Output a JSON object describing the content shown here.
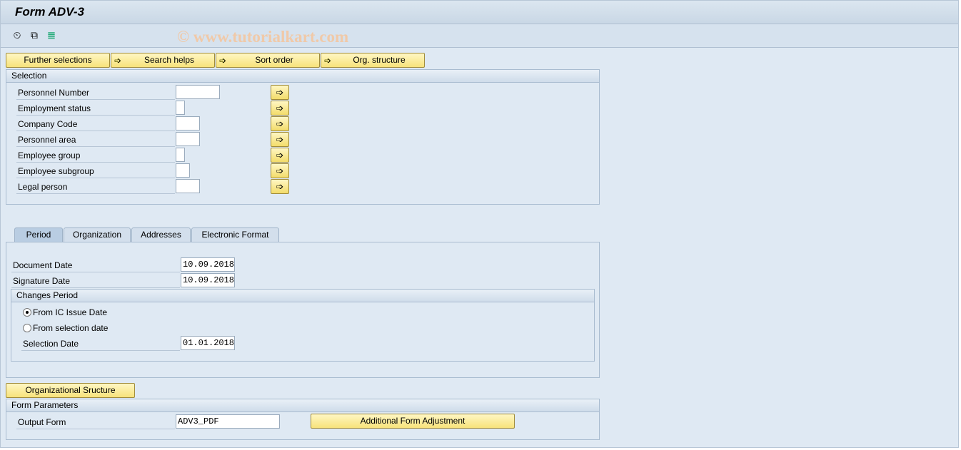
{
  "title": "Form ADV-3",
  "watermark": "© www.tutorialkart.com",
  "toolbar": {
    "icons": [
      "execute-clock-icon",
      "copy-variant-icon",
      "selection-options-icon"
    ]
  },
  "buttons": {
    "further": "Further selections",
    "search": "Search helps",
    "sort": "Sort order",
    "org": "Org. structure"
  },
  "selection": {
    "title": "Selection",
    "fields": [
      {
        "label": "Personnel Number",
        "value": ""
      },
      {
        "label": "Employment status",
        "value": ""
      },
      {
        "label": "Company Code",
        "value": ""
      },
      {
        "label": "Personnel area",
        "value": ""
      },
      {
        "label": "Employee group",
        "value": ""
      },
      {
        "label": "Employee subgroup",
        "value": ""
      },
      {
        "label": "Legal person",
        "value": ""
      }
    ]
  },
  "tabs": [
    "Period",
    "Organization",
    "Addresses",
    "Electronic Format"
  ],
  "period": {
    "document_date_label": "Document Date",
    "document_date": "10.09.2018",
    "signature_date_label": "Signature Date",
    "signature_date": "10.09.2018",
    "changes": {
      "title": "Changes Period",
      "radio1": "From IC Issue Date",
      "radio2": "From selection date",
      "selected": "From IC Issue Date",
      "selection_date_label": "Selection Date",
      "selection_date": "01.01.2018"
    }
  },
  "org_button": "Organizational Sructure",
  "form_params": {
    "title": "Form Parameters",
    "output_label": "Output Form",
    "output_value": "ADV3_PDF",
    "adjust_button": "Additional Form Adjustment"
  }
}
